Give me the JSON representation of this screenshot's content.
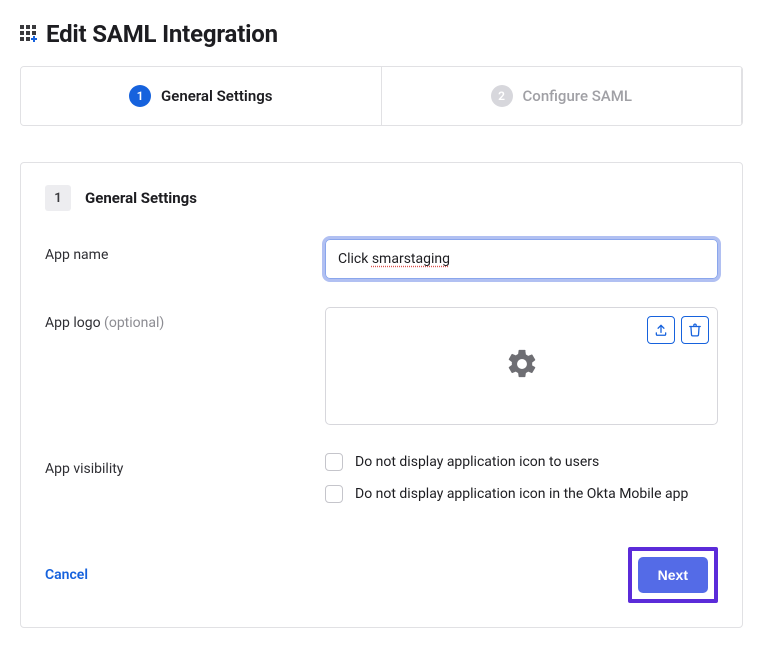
{
  "page_title": "Edit SAML Integration",
  "tabs": [
    {
      "num": "1",
      "label": "General Settings",
      "active": true
    },
    {
      "num": "2",
      "label": "Configure SAML",
      "active": false
    }
  ],
  "section": {
    "step": "1",
    "title": "General Settings"
  },
  "fields": {
    "app_name": {
      "label": "App name",
      "value": "Click smarstaging"
    },
    "app_logo": {
      "label": "App logo ",
      "optional": "(optional)"
    },
    "app_visibility": {
      "label": "App visibility",
      "opt1": "Do not display application icon to users",
      "opt2": "Do not display application icon in the Okta Mobile app",
      "checked1": false,
      "checked2": false
    }
  },
  "actions": {
    "cancel": "Cancel",
    "next": "Next"
  }
}
